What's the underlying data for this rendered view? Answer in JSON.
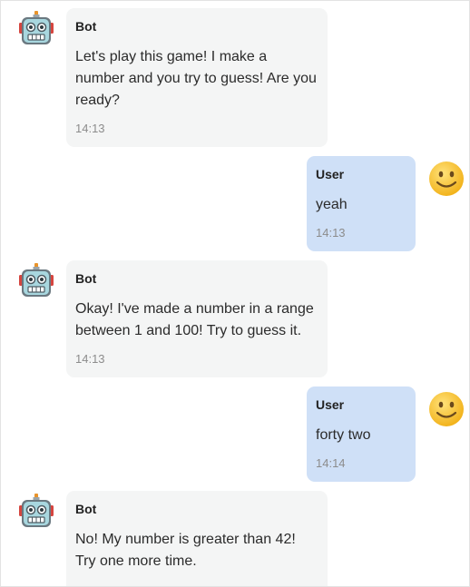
{
  "messages": [
    {
      "sender": "Bot",
      "text": "Let's play this game! I make a number and you try to guess! Are you ready?",
      "time": "14:13"
    },
    {
      "sender": "User",
      "text": "yeah",
      "time": "14:13"
    },
    {
      "sender": "Bot",
      "text": "Okay! I've made a number in a range between 1 and 100! Try to guess it.",
      "time": "14:13"
    },
    {
      "sender": "User",
      "text": "forty two",
      "time": "14:14"
    },
    {
      "sender": "Bot",
      "text": "No! My number is greater than 42! Try one more time.",
      "time": ""
    }
  ],
  "icons": {
    "bot_avatar": "robot-icon",
    "user_avatar": "smiley-face-icon"
  },
  "colors": {
    "bot_bubble": "#f4f5f5",
    "user_bubble": "#cfe0f7",
    "timestamp": "#8c8c8c"
  }
}
